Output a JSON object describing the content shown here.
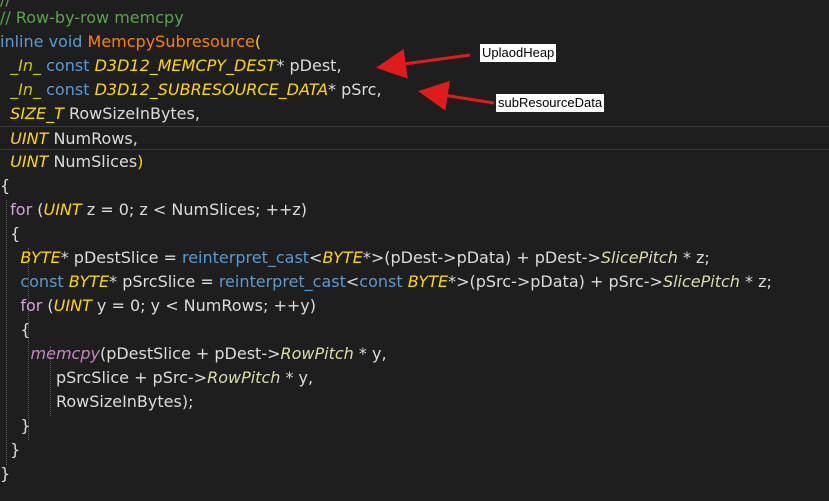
{
  "code": {
    "line_top": "//",
    "line_comment": "// Row-by-row memcpy",
    "sig_inline": "inline",
    "sig_void": "void",
    "sig_name": "MemcpySubresource",
    "sig_paren": "(",
    "p1_in": "_In_",
    "p1_const": "const",
    "p1_type": "D3D12_MEMCPY_DEST",
    "p1_rest": "* pDest,",
    "p2_in": "_In_",
    "p2_const": "const",
    "p2_type": "D3D12_SUBRESOURCE_DATA",
    "p2_rest": "* pSrc,",
    "p3_type": "SIZE_T",
    "p3_rest": "RowSizeInBytes,",
    "p4_type": "UINT",
    "p4_rest": "NumRows,",
    "p5_type": "UINT",
    "p5_rest": "NumSlices",
    "p5_close": ")",
    "open1": "{",
    "for1_kw": "for",
    "for1_a": " (",
    "for1_type": "UINT",
    "for1_rest": " z = 0; z < NumSlices; ++z)",
    "open2": "{",
    "l1_type": "BYTE",
    "l1_a": "* pDestSlice = ",
    "l1_cast": "reinterpret_cast",
    "l1_b": "<",
    "l1_type2": "BYTE",
    "l1_c": "*>(pDest->pData) + pDest->",
    "l1_mem": "SlicePitch",
    "l1_d": " * z;",
    "l2_const": "const",
    "l2_type": "BYTE",
    "l2_a": "* pSrcSlice = ",
    "l2_cast": "reinterpret_cast",
    "l2_b": "<",
    "l2_const2": "const",
    "l2_type2": "BYTE",
    "l2_c": "*>(pSrc->pData) + pSrc->",
    "l2_mem": "SlicePitch",
    "l2_d": " * z;",
    "for2_kw": "for",
    "for2_a": " (",
    "for2_type": "UINT",
    "for2_rest": " y = 0; y < NumRows; ++y)",
    "open3": "{",
    "mc_fn": "memcpy",
    "mc_a": "(pDestSlice + pDest->",
    "mc_mem": "RowPitch",
    "mc_b": " * y,",
    "mc2_a": "pSrcSlice + pSrc->",
    "mc2_mem": "RowPitch",
    "mc2_b": " * y,",
    "mc3": "RowSizeInBytes);",
    "close3": "}",
    "close2": "}",
    "close1": "}"
  },
  "annotations": {
    "upload": "UplaodHeap",
    "subres": "subResourceData"
  },
  "colors": {
    "background": "#1e1e1e",
    "comment": "#57a64a",
    "keyword": "#569cd6",
    "function": "#ff8000",
    "type": "#ffd700",
    "arrow": "#e01b1b"
  }
}
